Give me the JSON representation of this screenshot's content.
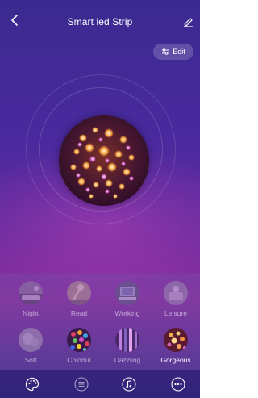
{
  "header": {
    "title": "Smart led Strip",
    "back_icon": "chevron-left-icon",
    "rename_icon": "pencil-icon"
  },
  "toolbar": {
    "edit_label": "Edit",
    "edit_icon": "sliders-icon"
  },
  "current_scene": {
    "image": "gorgeous-fireworks-image"
  },
  "scenes": [
    {
      "label": "Night",
      "active": false
    },
    {
      "label": "Read",
      "active": false
    },
    {
      "label": "Working",
      "active": false
    },
    {
      "label": "Leisure",
      "active": false
    },
    {
      "label": "Soft",
      "active": false
    },
    {
      "label": "Colorful",
      "active": false
    },
    {
      "label": "Dazzling",
      "active": false
    },
    {
      "label": "Gorgeous",
      "active": true
    }
  ],
  "bottom_tabs": [
    {
      "icon": "palette-icon",
      "active": true
    },
    {
      "icon": "list-icon",
      "active": false
    },
    {
      "icon": "music-icon",
      "active": false
    },
    {
      "icon": "more-icon",
      "active": false
    }
  ],
  "colors": {
    "background_top": "#3a2a8f",
    "background_mid": "#8a2ea0",
    "accent": "#ffffff"
  }
}
